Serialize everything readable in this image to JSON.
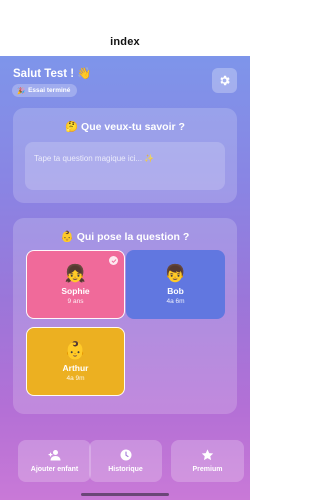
{
  "header": {
    "title": "index"
  },
  "greeting": {
    "text": "Salut Test ! 👋"
  },
  "status": {
    "icon": "🎉",
    "label": "Essai terminé"
  },
  "settings": {
    "icon": "gear-icon"
  },
  "question_card": {
    "title": "🤔 Que veux-tu savoir ?",
    "placeholder": "Tape ta question magique ici... ✨"
  },
  "who_card": {
    "title": "👶 Qui pose la question ?",
    "profiles": [
      {
        "emoji": "👧",
        "name": "Sophie",
        "age": "9 ans",
        "color": "#f06a9a",
        "selected": true
      },
      {
        "emoji": "👦",
        "name": "Bob",
        "age": "4a 6m",
        "color": "#6177e0",
        "selected": false
      },
      {
        "emoji": "👶",
        "name": "Arthur",
        "age": "4a 9m",
        "color": "#ecb021",
        "selected": false
      }
    ]
  },
  "bottom_nav": [
    {
      "icon": "add-person-icon",
      "label": "Ajouter enfant"
    },
    {
      "icon": "clock-icon",
      "label": "Historique"
    },
    {
      "icon": "star-icon",
      "label": "Premium"
    }
  ]
}
